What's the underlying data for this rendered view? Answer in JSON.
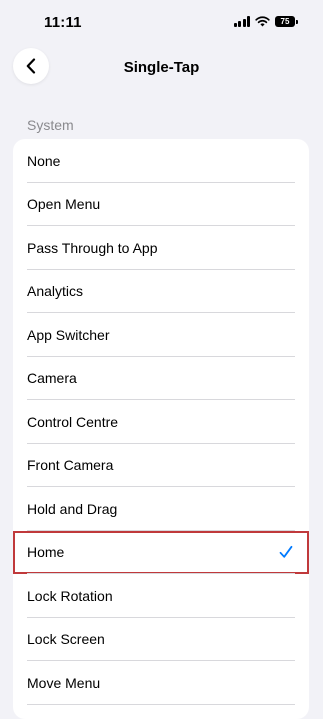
{
  "status_bar": {
    "time": "11:11",
    "battery": "75",
    "icons": [
      "signal-icon",
      "wifi-icon",
      "battery-icon"
    ]
  },
  "nav": {
    "title": "Single-Tap",
    "back_icon": "chevron-left-icon"
  },
  "section": {
    "header": "System"
  },
  "items": [
    {
      "label": "None",
      "selected": false
    },
    {
      "label": "Open Menu",
      "selected": false
    },
    {
      "label": "Pass Through to App",
      "selected": false
    },
    {
      "label": "Analytics",
      "selected": false
    },
    {
      "label": "App Switcher",
      "selected": false
    },
    {
      "label": "Camera",
      "selected": false
    },
    {
      "label": "Control Centre",
      "selected": false
    },
    {
      "label": "Front Camera",
      "selected": false
    },
    {
      "label": "Hold and Drag",
      "selected": false
    },
    {
      "label": "Home",
      "selected": true
    },
    {
      "label": "Lock Rotation",
      "selected": false
    },
    {
      "label": "Lock Screen",
      "selected": false
    },
    {
      "label": "Move Menu",
      "selected": false
    }
  ],
  "colors": {
    "background": "#f2f2f7",
    "accent": "#007aff",
    "selection_outline": "#c0393b",
    "section_header": "#8a8a8e"
  }
}
